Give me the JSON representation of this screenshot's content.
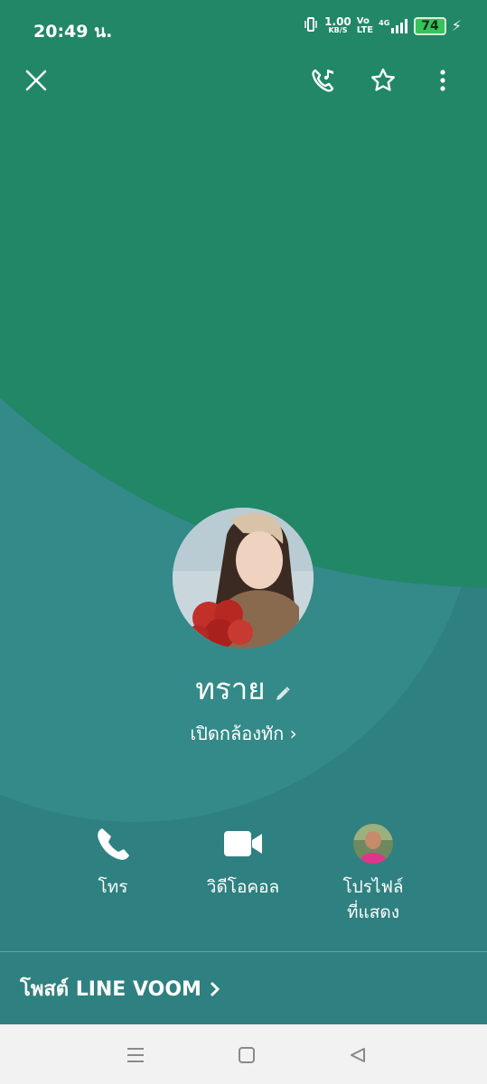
{
  "status_bar": {
    "time": "20:49 น.",
    "net_speed": "1.00",
    "net_unit": "KB/S",
    "volte_top": "Vo",
    "volte_bottom": "LTE",
    "network": "4G",
    "battery": "74"
  },
  "profile": {
    "name": "ทราย",
    "cover_camera_link": "เปิดกล้องทัก"
  },
  "actions": [
    {
      "label": "โทร"
    },
    {
      "label": "วิดีโอคอล"
    },
    {
      "label_line1": "โปรไฟล์",
      "label_line2": "ที่แสดง"
    }
  ],
  "voom": {
    "label": "โพสต์ LINE VOOM"
  },
  "colors": {
    "background_teal": "#2f8080",
    "arc_green": "#218767",
    "arc_teal": "#338a89",
    "nav_bar": "#f2f2f2"
  }
}
